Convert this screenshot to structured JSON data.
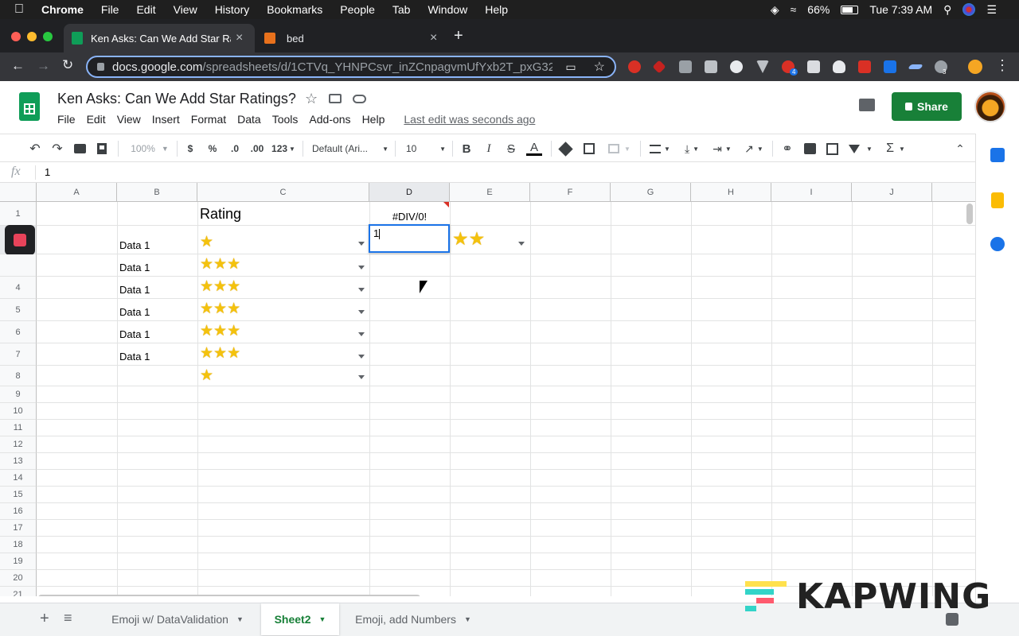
{
  "mac_menu": {
    "apple": "",
    "app": "Chrome",
    "items": [
      "File",
      "Edit",
      "View",
      "History",
      "Bookmarks",
      "People",
      "Tab",
      "Window",
      "Help"
    ],
    "battery": "66%",
    "clock": "Tue 7:39 AM"
  },
  "browser": {
    "tabs": [
      {
        "label": "Ken Asks: Can We Add Star Ra",
        "close": "×"
      },
      {
        "label": "bed",
        "close": "×"
      }
    ],
    "new_tab": "+",
    "url_host": "docs.google.com",
    "url_path": "/spreadsheets/d/1CTVq_YHNPCsvr_inZCnpagvmUfYxb2T_pxG32z...",
    "ext_badges": [
      "4",
      "3"
    ]
  },
  "doc": {
    "title": "Ken Asks: Can We Add Star Ratings?",
    "menus": [
      "File",
      "Edit",
      "View",
      "Insert",
      "Format",
      "Data",
      "Tools",
      "Add-ons",
      "Help"
    ],
    "last_edit": "Last edit was seconds ago",
    "share": "Share"
  },
  "toolbar": {
    "zoom": "100%",
    "currency": "$",
    "percent": "%",
    "dec_less": ".0",
    "dec_more": ".00",
    "format": "123",
    "font": "Default (Ari...",
    "size": "10",
    "bold": "B",
    "italic": "I",
    "strike": "S",
    "textcolor": "A",
    "sum": "Σ"
  },
  "formula": {
    "fx": "fx",
    "value": "1"
  },
  "grid": {
    "columns": [
      "A",
      "B",
      "C",
      "D",
      "E",
      "F",
      "G",
      "H",
      "I",
      "J"
    ],
    "rows": [
      "1",
      "2",
      "3",
      "4",
      "5",
      "6",
      "7",
      "8",
      "9",
      "10",
      "11",
      "12",
      "13",
      "14",
      "15",
      "16",
      "17",
      "18",
      "19",
      "20",
      "21"
    ],
    "header_rating": "Rating",
    "d1": "#DIV/0!",
    "d2_editing": "1",
    "data_label": "Data 1",
    "star": "⭐",
    "ratings": [
      1,
      3,
      3,
      3,
      3,
      3,
      1
    ],
    "e2_stars": 2
  },
  "sheets": {
    "add": "+",
    "list": "≡",
    "tabs": [
      "Emoji w/ DataValidation",
      "Sheet2",
      "Emoji, add Numbers"
    ],
    "active": 1
  },
  "watermark": "KAPWING",
  "colors": {
    "sheets_green": "#0f9d58",
    "share_green": "#188038",
    "selection_blue": "#1a73e8",
    "star": "#f4c20d"
  }
}
